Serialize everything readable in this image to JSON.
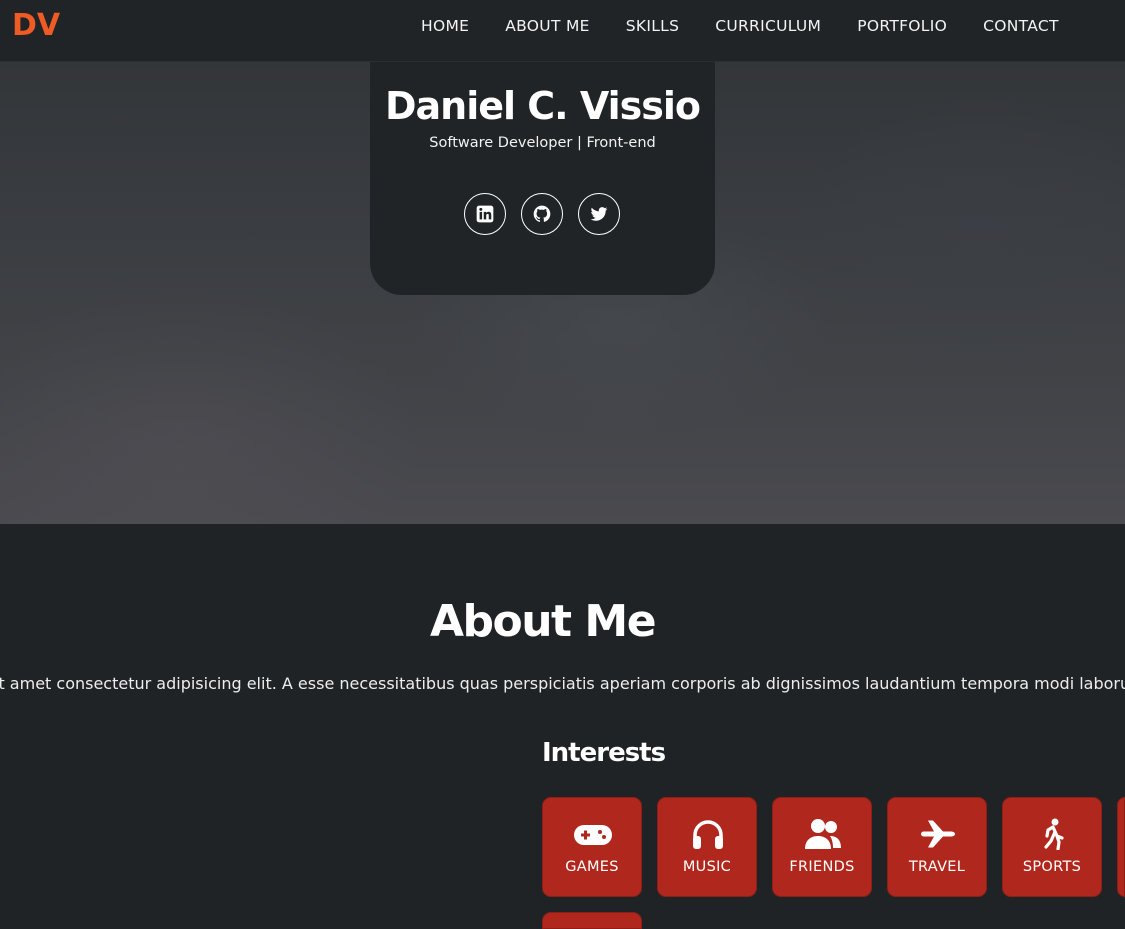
{
  "navbar": {
    "logo": "DV",
    "links": [
      "HOME",
      "ABOUT ME",
      "SKILLS",
      "CURRICULUM",
      "PORTFOLIO",
      "CONTACT"
    ]
  },
  "hero": {
    "name": "Daniel C. Vissio",
    "role": "Software Developer | Front-end",
    "social": [
      {
        "icon": "linkedin-icon"
      },
      {
        "icon": "github-icon"
      },
      {
        "icon": "twitter-icon"
      }
    ]
  },
  "about": {
    "title": "About Me",
    "text": "it amet consectetur adipisicing elit. A esse necessitatibus quas perspiciatis aperiam corporis ab dignissimos laudantium tempora modi laborum",
    "interests_title": "Interests",
    "interests": [
      {
        "label": "GAMES",
        "icon": "gamepad-icon"
      },
      {
        "label": "MUSIC",
        "icon": "headphones-icon"
      },
      {
        "label": "FRIENDS",
        "icon": "friends-icon"
      },
      {
        "label": "TRAVEL",
        "icon": "plane-icon"
      },
      {
        "label": "SPORTS",
        "icon": "running-icon"
      }
    ]
  },
  "colors": {
    "accent": "#ef5b25",
    "card_red": "#b0281d",
    "background": "#1f2326"
  }
}
